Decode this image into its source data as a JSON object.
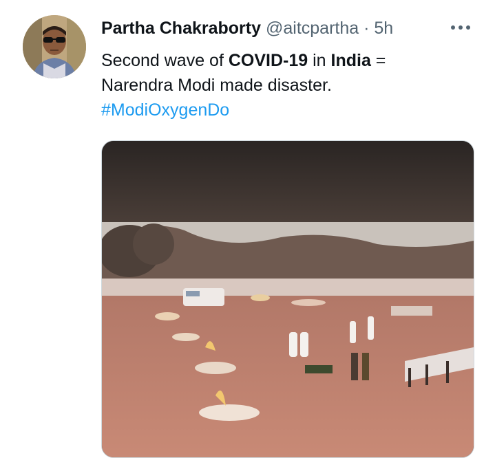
{
  "tweet": {
    "author_name": "Partha Chakraborty",
    "handle": "@aitcpartha",
    "separator": "·",
    "time": "5h",
    "text_part1": "Second wave of ",
    "text_bold1": "COVID-19",
    "text_part2": " in ",
    "text_bold2": "India",
    "text_part3": " =",
    "text_line2": "Narendra Modi made disaster.",
    "hashtag": "#ModiOxygenDo"
  },
  "icons": {
    "more": "more-horizontal-icon"
  },
  "colors": {
    "link": "#1d9bf0",
    "secondary_text": "#536471",
    "primary_text": "#0f1419"
  }
}
